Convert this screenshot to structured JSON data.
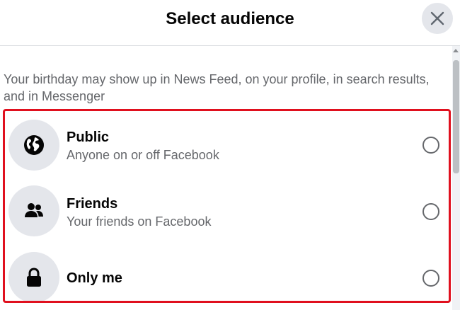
{
  "dialog": {
    "title": "Select audience",
    "close_icon": "close-icon",
    "description": "Your birthday may show up in News Feed, on your profile, in search results, and in Messenger"
  },
  "options": [
    {
      "label": "Public",
      "sublabel": "Anyone on or off Facebook",
      "icon": "globe-icon",
      "selected": false
    },
    {
      "label": "Friends",
      "sublabel": "Your friends on Facebook",
      "icon": "friends-icon",
      "selected": false
    },
    {
      "label": "Only me",
      "sublabel": "",
      "icon": "lock-icon",
      "selected": false
    }
  ],
  "colors": {
    "highlight_border": "#e0101e",
    "icon_bg": "#e4e6eb",
    "secondary_text": "#65676b"
  }
}
